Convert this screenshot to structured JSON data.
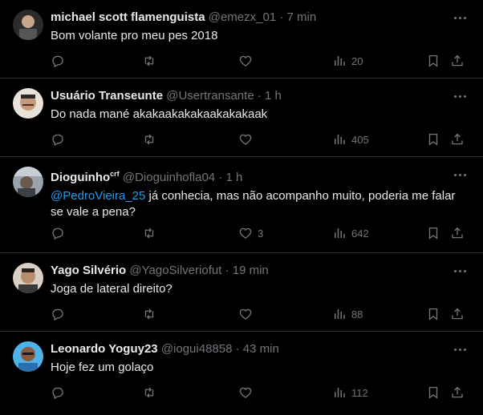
{
  "tweets": [
    {
      "name": "michael scott flamenguista",
      "handle": "@emezx_01",
      "separator": "·",
      "time": "7 min",
      "text": "Bom volante pro meu pes 2018",
      "likes": "",
      "views": "20",
      "avatar_color": "#5a4a3a"
    },
    {
      "name": "Usuário Transeunte",
      "handle": "@Usertransante",
      "separator": "·",
      "time": "1 h",
      "text": "Do nada mané akakaakakakaakakakaak",
      "likes": "",
      "views": "405",
      "avatar_color": "#c9b8a0"
    },
    {
      "name": "Dioguinho",
      "badge": "crf",
      "handle": "@Dioguinhofla04",
      "separator": "·",
      "time": "1 h",
      "mention": "@PedroVieira_25",
      "text": " já conhecia, mas não acompanho muito, poderia me falar se vale a pena?",
      "likes": "3",
      "views": "642",
      "avatar_color": "#7a7f86"
    },
    {
      "name": "Yago Silvério",
      "handle": "@YagoSilveriofut",
      "separator": "·",
      "time": "19 min",
      "text": "Joga de lateral direito?",
      "likes": "",
      "views": "88",
      "avatar_color": "#b08a70"
    },
    {
      "name": "Leonardo Yoguy23",
      "handle": "@iogui48858",
      "separator": "·",
      "time": "43 min",
      "text": "Hoje fez um golaço",
      "likes": "",
      "views": "112",
      "avatar_color": "#4fb3e8"
    }
  ],
  "icons": {
    "reply": "reply-icon",
    "retweet": "retweet-icon",
    "like": "heart-icon",
    "views": "views-icon",
    "bookmark": "bookmark-icon",
    "share": "share-icon",
    "more": "more-icon"
  }
}
